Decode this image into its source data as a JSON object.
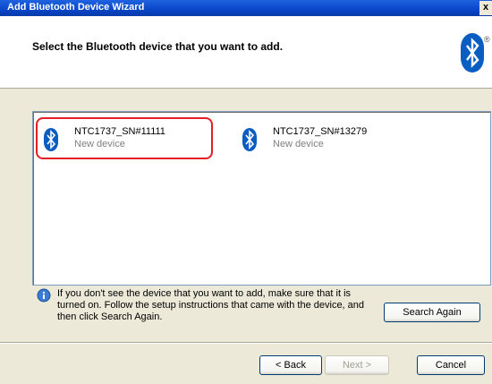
{
  "window": {
    "title": "Add Bluetooth Device Wizard",
    "close_glyph": "x"
  },
  "header": {
    "heading": "Select the Bluetooth device that you want to add.",
    "logo_mark": "®"
  },
  "devices": [
    {
      "name": "NTC1737_SN#11111",
      "status": "New device"
    },
    {
      "name": "NTC1737_SN#13279",
      "status": "New device"
    }
  ],
  "info": {
    "text": "If you don't see the device that you want to add, make sure that it is turned on. Follow the setup instructions that came with the device, and then click Search Again."
  },
  "buttons": {
    "search_again": "Search Again",
    "back": "< Back",
    "next": "Next >",
    "cancel": "Cancel"
  },
  "colors": {
    "titlebar": "#0a46c8",
    "bluetooth": "#0a5ec2",
    "highlight": "#e31e24"
  }
}
